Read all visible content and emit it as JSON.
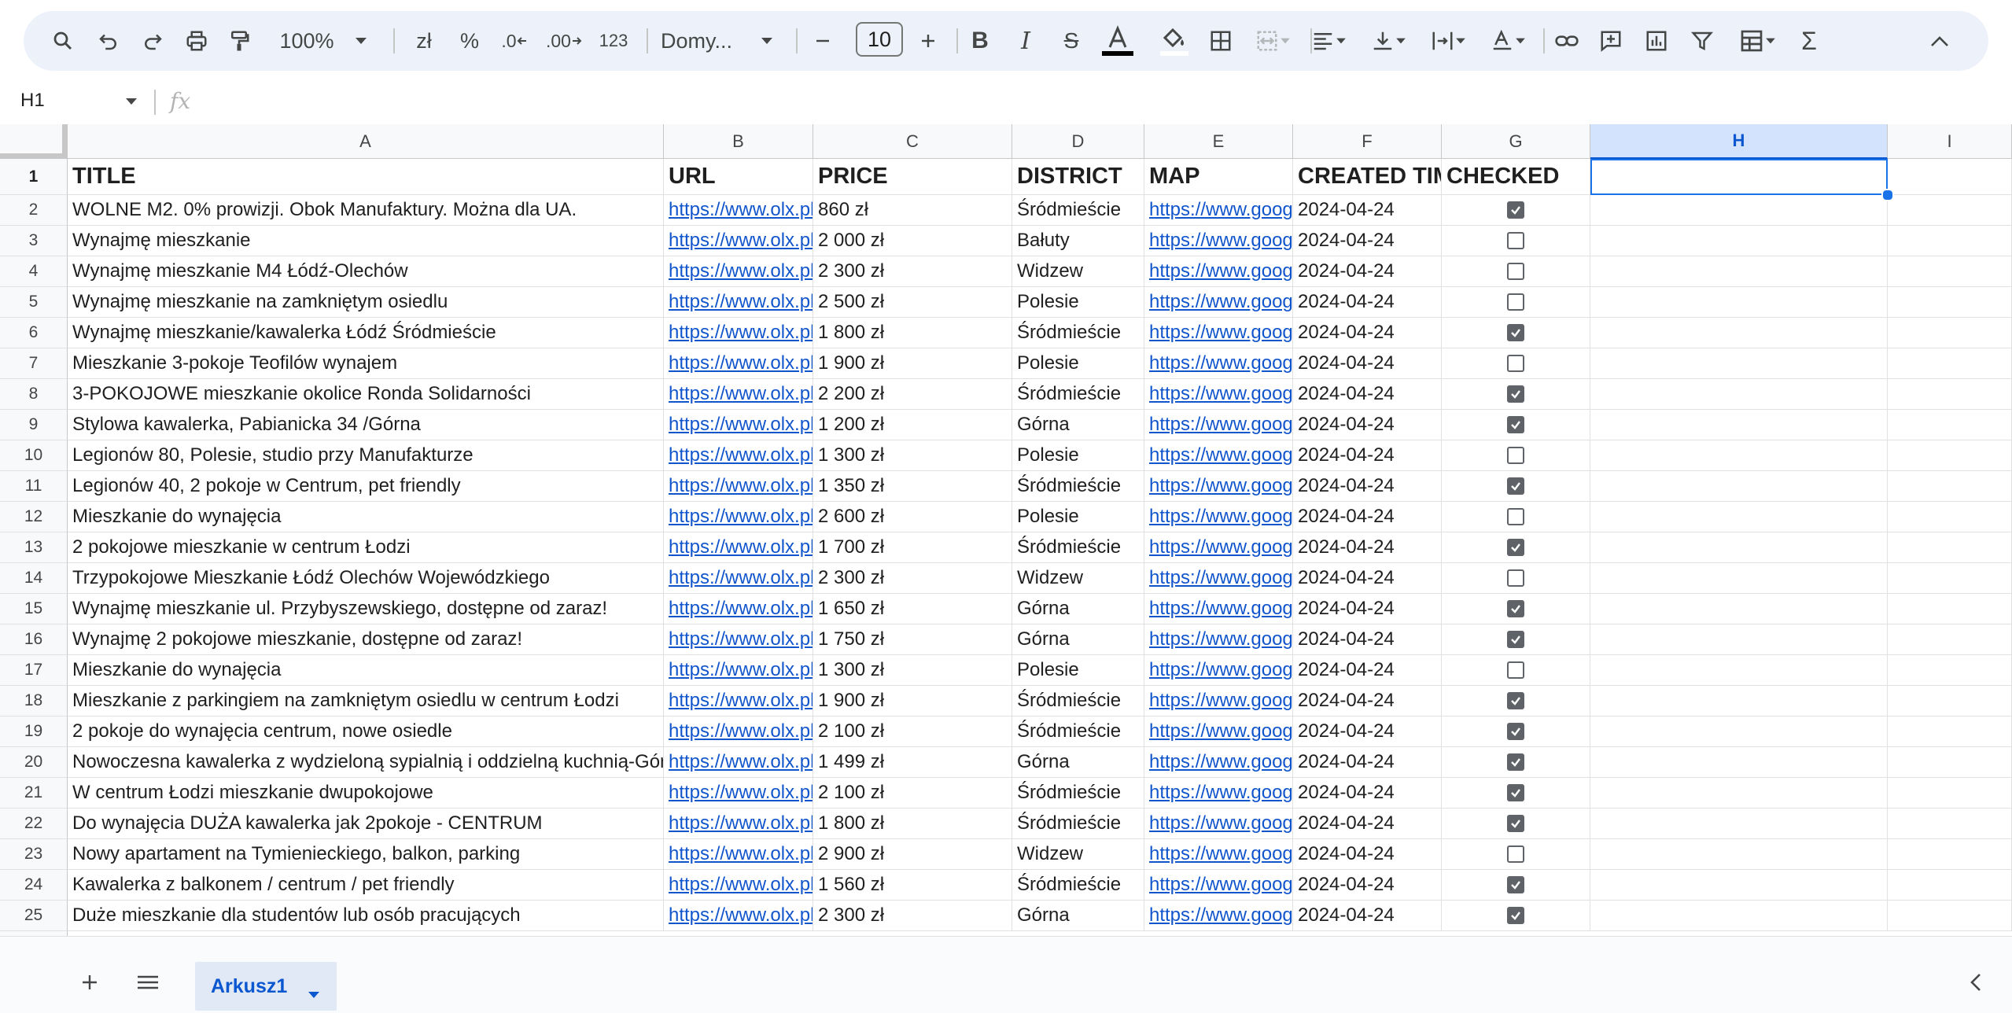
{
  "toolbar": {
    "zoom": "100%",
    "currency": "zł",
    "percent": "%",
    "dec_decrease": ".0",
    "dec_increase": ".00",
    "number_format": "123",
    "font_name": "Domy...",
    "font_size": "10",
    "icons": [
      "search-icon",
      "undo-icon",
      "redo-icon",
      "print-icon",
      "paint-format-icon",
      "zoom-dropdown",
      "currency-icon",
      "percent-icon",
      "decrease-decimal-icon",
      "increase-decimal-icon",
      "number-format-icon",
      "font-dropdown",
      "minus-icon",
      "plus-icon",
      "bold-icon",
      "italic-icon",
      "strikethrough-icon",
      "text-color-icon",
      "fill-color-icon",
      "borders-icon",
      "merge-cells-icon",
      "horizontal-align-icon",
      "vertical-align-icon",
      "text-wrap-icon",
      "text-rotation-icon",
      "link-icon",
      "comment-icon",
      "chart-icon",
      "filter-icon",
      "table-icon",
      "functions-icon",
      "collapse-icon"
    ]
  },
  "formula_bar": {
    "name_box": "H1",
    "fx": "fx",
    "value": ""
  },
  "columns": [
    "A",
    "B",
    "C",
    "D",
    "E",
    "F",
    "G",
    "H",
    "I"
  ],
  "selected_column": "H",
  "selected_cell": "H1",
  "header_row": {
    "title": "TITLE",
    "url": "URL",
    "price": "PRICE",
    "district": "DISTRICT",
    "map": "MAP",
    "created": "CREATED TIME",
    "checked": "CHECKED"
  },
  "rows": [
    {
      "n": "2",
      "title": "WOLNE M2. 0% prowizji. Obok Manufaktury. Można dla UA.",
      "url": "https://www.olx.pl",
      "price": "860 zł",
      "district": "Śródmieście",
      "map": "https://www.google.com/maps",
      "created": "2024-04-24",
      "checked": true
    },
    {
      "n": "3",
      "title": "Wynajmę mieszkanie",
      "url": "https://www.olx.pl",
      "price": "2 000 zł",
      "district": "Bałuty",
      "map": "https://www.google.com/maps",
      "created": "2024-04-24",
      "checked": false
    },
    {
      "n": "4",
      "title": "Wynajmę mieszkanie M4 Łódź-Olechów",
      "url": "https://www.olx.pl",
      "price": "2 300 zł",
      "district": "Widzew",
      "map": "https://www.google.com/maps",
      "created": "2024-04-24",
      "checked": false
    },
    {
      "n": "5",
      "title": "Wynajmę mieszkanie na zamkniętym osiedlu",
      "url": "https://www.olx.pl",
      "price": "2 500 zł",
      "district": "Polesie",
      "map": "https://www.google.com/maps",
      "created": "2024-04-24",
      "checked": false
    },
    {
      "n": "6",
      "title": "Wynajmę mieszkanie/kawalerka Łódź Śródmieście",
      "url": "https://www.olx.pl",
      "price": "1 800 zł",
      "district": "Śródmieście",
      "map": "https://www.google.com/maps",
      "created": "2024-04-24",
      "checked": true
    },
    {
      "n": "7",
      "title": "Mieszkanie 3-pokoje Teofilów wynajem",
      "url": "https://www.olx.pl",
      "price": "1 900 zł",
      "district": "Polesie",
      "map": "https://www.google.com/maps",
      "created": "2024-04-24",
      "checked": false
    },
    {
      "n": "8",
      "title": "3-POKOJOWE mieszkanie okolice Ronda Solidarności",
      "url": "https://www.olx.pl",
      "price": "2 200 zł",
      "district": "Śródmieście",
      "map": "https://www.google.com/maps",
      "created": "2024-04-24",
      "checked": true
    },
    {
      "n": "9",
      "title": "Stylowa kawalerka, Pabianicka 34 /Górna",
      "url": "https://www.olx.pl",
      "price": "1 200 zł",
      "district": "Górna",
      "map": "https://www.google.com/maps",
      "created": "2024-04-24",
      "checked": true
    },
    {
      "n": "10",
      "title": "Legionów 80, Polesie, studio przy Manufakturze",
      "url": "https://www.olx.pl",
      "price": "1 300 zł",
      "district": "Polesie",
      "map": "https://www.google.com/maps",
      "created": "2024-04-24",
      "checked": false
    },
    {
      "n": "11",
      "title": "Legionów 40, 2 pokoje w Centrum, pet friendly",
      "url": "https://www.olx.pl",
      "price": "1 350 zł",
      "district": "Śródmieście",
      "map": "https://www.google.com/maps",
      "created": "2024-04-24",
      "checked": true
    },
    {
      "n": "12",
      "title": "Mieszkanie do wynajęcia",
      "url": "https://www.olx.pl",
      "price": "2 600 zł",
      "district": "Polesie",
      "map": "https://www.google.com/maps",
      "created": "2024-04-24",
      "checked": false
    },
    {
      "n": "13",
      "title": "2 pokojowe mieszkanie w centrum Łodzi",
      "url": "https://www.olx.pl",
      "price": "1 700 zł",
      "district": "Śródmieście",
      "map": "https://www.google.com/maps",
      "created": "2024-04-24",
      "checked": true
    },
    {
      "n": "14",
      "title": "Trzypokojowe Mieszkanie Łódź Olechów Wojewódzkiego",
      "url": "https://www.olx.pl",
      "price": "2 300 zł",
      "district": "Widzew",
      "map": "https://www.google.com/maps",
      "created": "2024-04-24",
      "checked": false
    },
    {
      "n": "15",
      "title": "Wynajmę mieszkanie ul. Przybyszewskiego, dostępne od zaraz!",
      "url": "https://www.olx.pl",
      "price": "1 650 zł",
      "district": "Górna",
      "map": "https://www.google.com/maps",
      "created": "2024-04-24",
      "checked": true
    },
    {
      "n": "16",
      "title": "Wynajmę 2 pokojowe mieszkanie, dostępne od zaraz!",
      "url": "https://www.olx.pl",
      "price": "1 750 zł",
      "district": "Górna",
      "map": "https://www.google.com/maps",
      "created": "2024-04-24",
      "checked": true
    },
    {
      "n": "17",
      "title": "Mieszkanie  do wynajęcia",
      "url": "https://www.olx.pl",
      "price": "1 300 zł",
      "district": "Polesie",
      "map": "https://www.google.com/maps",
      "created": "2024-04-24",
      "checked": false
    },
    {
      "n": "18",
      "title": "Mieszkanie z parkingiem na zamkniętym osiedlu w centrum Łodzi",
      "url": "https://www.olx.pl",
      "price": "1 900 zł",
      "district": "Śródmieście",
      "map": "https://www.google.com/maps",
      "created": "2024-04-24",
      "checked": true
    },
    {
      "n": "19",
      "title": "2 pokoje do wynajęcia centrum, nowe osiedle",
      "url": "https://www.olx.pl",
      "price": "2 100 zł",
      "district": "Śródmieście",
      "map": "https://www.google.com/maps",
      "created": "2024-04-24",
      "checked": true
    },
    {
      "n": "20",
      "title": "Nowoczesna kawalerka z wydzieloną sypialnią i oddzielną kuchnią-Górna",
      "url": "https://www.olx.pl",
      "price": "1 499 zł",
      "district": "Górna",
      "map": "https://www.google.com/maps",
      "created": "2024-04-24",
      "checked": true
    },
    {
      "n": "21",
      "title": "W centrum Łodzi mieszkanie dwupokojowe",
      "url": "https://www.olx.pl",
      "price": "2 100 zł",
      "district": "Śródmieście",
      "map": "https://www.google.com/maps",
      "created": "2024-04-24",
      "checked": true
    },
    {
      "n": "22",
      "title": "Do wynajęcia DUŻA kawalerka jak 2pokoje - CENTRUM",
      "url": "https://www.olx.pl",
      "price": "1 800 zł",
      "district": "Śródmieście",
      "map": "https://www.google.com/maps",
      "created": "2024-04-24",
      "checked": true
    },
    {
      "n": "23",
      "title": "Nowy apartament na Tymienieckiego, balkon, parking",
      "url": "https://www.olx.pl",
      "price": "2 900 zł",
      "district": "Widzew",
      "map": "https://www.google.com/maps",
      "created": "2024-04-24",
      "checked": false
    },
    {
      "n": "24",
      "title": "Kawalerka z balkonem / centrum / pet friendly",
      "url": "https://www.olx.pl",
      "price": "1 560 zł",
      "district": "Śródmieście",
      "map": "https://www.google.com/maps",
      "created": "2024-04-24",
      "checked": true
    },
    {
      "n": "25",
      "title": "Duże mieszkanie dla studentów lub osób pracujących",
      "url": "https://www.olx.pl",
      "price": "2 300 zł",
      "district": "Górna",
      "map": "https://www.google.com/maps",
      "created": "2024-04-24",
      "checked": true
    }
  ],
  "bottom_bar": {
    "sheet_tab": "Arkusz1",
    "icons": [
      "add-sheet-icon",
      "all-sheets-icon",
      "sheet-menu-icon",
      "explore-collapse-icon"
    ]
  },
  "colors": {
    "toolbar_bg": "#edf2fa",
    "selection": "#1a73e8",
    "link": "#1155cc",
    "selected_header_bg": "#d3e3fd",
    "tab_text": "#0b57d0"
  }
}
